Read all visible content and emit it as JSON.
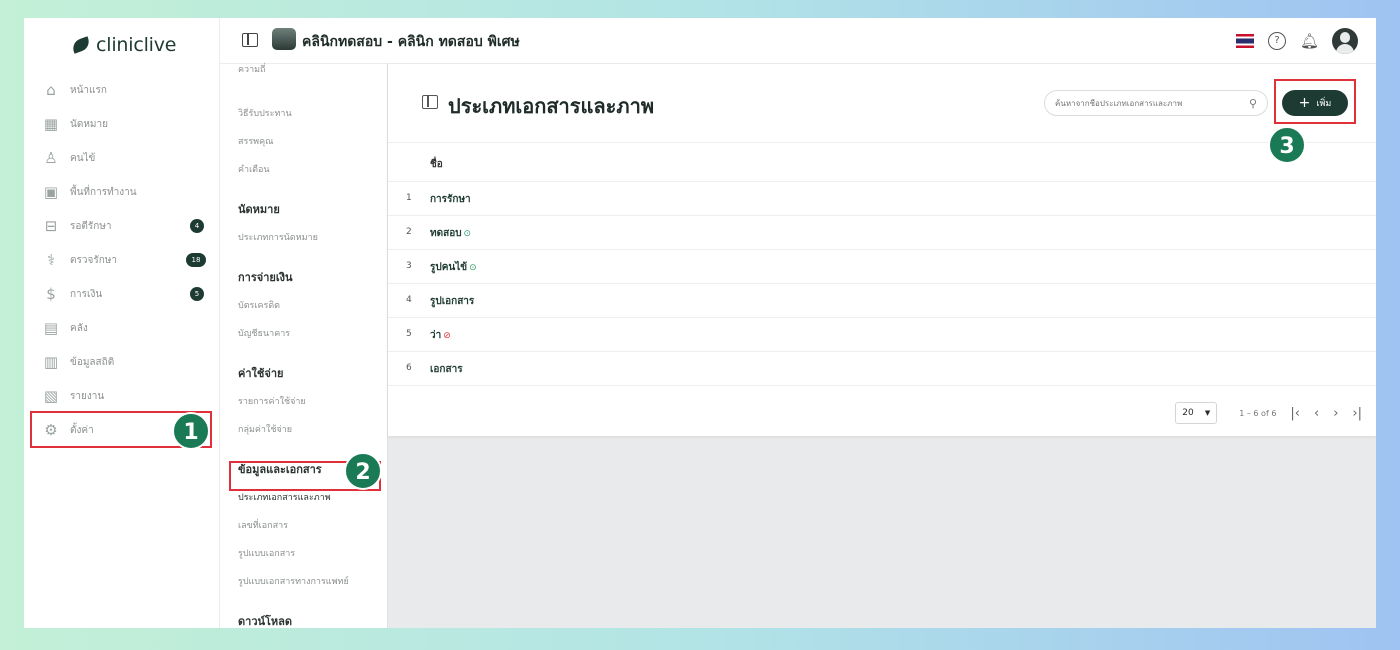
{
  "brand": {
    "logo_text": "cliniclive"
  },
  "sidebar": {
    "items": [
      {
        "label": "หน้าแรก",
        "icon": "home-icon"
      },
      {
        "label": "นัดหมาย",
        "icon": "calendar-icon"
      },
      {
        "label": "คนไข้",
        "icon": "user-icon"
      },
      {
        "label": "พื้นที่การทำงาน",
        "icon": "workspace-icon"
      },
      {
        "label": "รอตีรักษา",
        "icon": "waiting-icon",
        "badge": "4"
      },
      {
        "label": "ตรวจรักษา",
        "icon": "stethoscope-icon",
        "badge": "18"
      },
      {
        "label": "การเงิน",
        "icon": "money-icon",
        "badge": "5"
      },
      {
        "label": "คลัง",
        "icon": "inventory-icon"
      },
      {
        "label": "ข้อมูลสถิติ",
        "icon": "stats-icon"
      },
      {
        "label": "รายงาน",
        "icon": "report-icon"
      },
      {
        "label": "ตั้งค่า",
        "icon": "gear-icon"
      }
    ]
  },
  "header": {
    "clinic_title": "คลินิกทดสอบ - คลินิก ทดสอบ พิเศษ"
  },
  "subnav": {
    "top_items": [
      "ความถี่",
      "วิธีรับประทาน",
      "สรรพคุณ",
      "คำเตือน"
    ],
    "sections": [
      {
        "title": "นัดหมาย",
        "items": [
          "ประเภทการนัดหมาย"
        ]
      },
      {
        "title": "การจ่ายเงิน",
        "items": [
          "บัตรเครดิต",
          "บัญชีธนาคาร"
        ]
      },
      {
        "title": "ค่าใช้จ่าย",
        "items": [
          "รายการค่าใช้จ่าย",
          "กลุ่มค่าใช้จ่าย"
        ]
      },
      {
        "title": "ข้อมูลและเอกสาร",
        "items": [
          "ประเภทเอกสารและภาพ",
          "เลขที่เอกสาร",
          "รูปแบบเอกสาร",
          "รูปแบบเอกสารทางการแพทย์"
        ]
      },
      {
        "title": "ดาวน์โหลด",
        "items": []
      }
    ]
  },
  "main": {
    "page_title": "ประเภทเอกสารและภาพ",
    "search_placeholder": "ค้นหาจากชื่อประเภทเอกสารและภาพ",
    "add_label": "เพิ่ม",
    "column_name": "ชื่อ",
    "rows": [
      {
        "num": "1",
        "name": "การรักษา",
        "status": ""
      },
      {
        "num": "2",
        "name": "ทดสอบ",
        "status": "active"
      },
      {
        "num": "3",
        "name": "รูปคนไข้",
        "status": "active"
      },
      {
        "num": "4",
        "name": "รูปเอกสาร",
        "status": ""
      },
      {
        "num": "5",
        "name": "ว่า",
        "status": "disabled"
      },
      {
        "num": "6",
        "name": "เอกสาร",
        "status": ""
      }
    ],
    "pagination": {
      "per_page": "20",
      "range": "1 – 6 of 6"
    }
  },
  "steps": [
    "1",
    "2",
    "3"
  ],
  "colors": {
    "brand": "#1e3b33",
    "highlight": "#e0313a",
    "step": "#1a7a55"
  }
}
